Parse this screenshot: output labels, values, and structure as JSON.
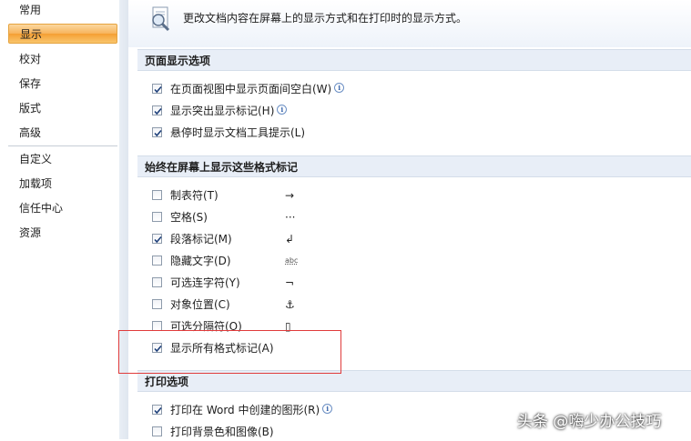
{
  "sidebar": {
    "items": [
      {
        "label": "常用"
      },
      {
        "label": "显示"
      },
      {
        "label": "校对"
      },
      {
        "label": "保存"
      },
      {
        "label": "版式"
      },
      {
        "label": "高级"
      },
      {
        "label": "自定义"
      },
      {
        "label": "加载项"
      },
      {
        "label": "信任中心"
      },
      {
        "label": "资源"
      }
    ],
    "selected": "显示"
  },
  "intro": {
    "text": "更改文档内容在屏幕上的显示方式和在打印时的显示方式。",
    "icon": "magnifier-document-icon"
  },
  "sections": {
    "page_display": {
      "title": "页面显示选项",
      "options": [
        {
          "label": "在页面视图中显示页面间空白(W)",
          "checked": true,
          "info": true
        },
        {
          "label": "显示突出显示标记(H)",
          "checked": true,
          "info": true
        },
        {
          "label": "悬停时显示文档工具提示(L)",
          "checked": true,
          "info": false
        }
      ]
    },
    "format_marks": {
      "title": "始终在屏幕上显示这些格式标记",
      "options": [
        {
          "label": "制表符(T)",
          "checked": false,
          "symbol": "→"
        },
        {
          "label": "空格(S)",
          "checked": false,
          "symbol": "···"
        },
        {
          "label": "段落标记(M)",
          "checked": true,
          "symbol": "↲"
        },
        {
          "label": "隐藏文字(D)",
          "checked": false,
          "symbol": "abc"
        },
        {
          "label": "可选连字符(Y)",
          "checked": false,
          "symbol": "¬"
        },
        {
          "label": "对象位置(C)",
          "checked": false,
          "symbol": "⚓"
        },
        {
          "label": "可选分隔符(O)",
          "checked": false,
          "symbol": "▯"
        },
        {
          "label": "显示所有格式标记(A)",
          "checked": true,
          "symbol": ""
        }
      ]
    },
    "print": {
      "title": "打印选项",
      "options": [
        {
          "label": "打印在 Word 中创建的图形(R)",
          "checked": true,
          "info": true
        },
        {
          "label": "打印背景色和图像(B)",
          "checked": false,
          "info": false
        }
      ]
    }
  },
  "watermark": "头条 @嗨少办公技巧",
  "colors": {
    "accent_selected": "#f7b35a",
    "section_bg": "#e8eef7",
    "highlight_border": "#e03b3b"
  }
}
